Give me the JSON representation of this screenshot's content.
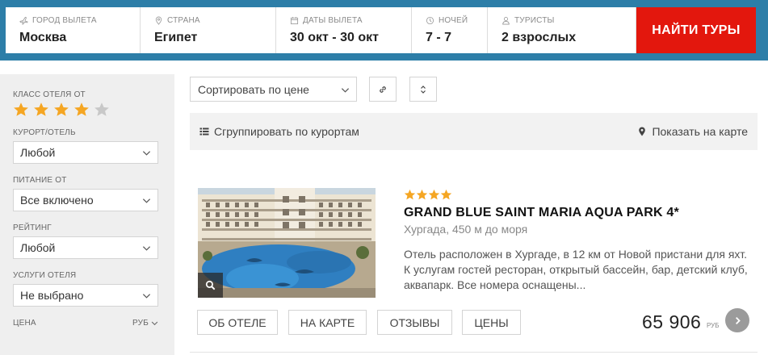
{
  "search": {
    "fields": [
      {
        "label": "Город вылета",
        "value": "Москва",
        "icon": "plane-icon"
      },
      {
        "label": "Страна",
        "value": "Египет",
        "icon": "location-pin-icon"
      },
      {
        "label": "Даты вылета",
        "value": "30 окт - 30 окт",
        "icon": "calendar-icon"
      },
      {
        "label": "Ночей",
        "value": "7 - 7",
        "icon": "moon-icon"
      },
      {
        "label": "Туристы",
        "value": "2 взрослых",
        "icon": "person-icon"
      }
    ],
    "button_label": "Найти туры"
  },
  "filters": {
    "stars_label": "Класс отеля от",
    "stars_value": 4,
    "stars_max": 5,
    "resort": {
      "label": "Курорт/отель",
      "value": "Любой"
    },
    "meal": {
      "label": "Питание от",
      "value": "Все включено"
    },
    "rating": {
      "label": "Рейтинг",
      "value": "Любой"
    },
    "services": {
      "label": "Услуги отеля",
      "value": "Не выбрано"
    },
    "price": {
      "label": "Цена",
      "currency": "руб"
    }
  },
  "toolbar": {
    "sort_value": "Сортировать по цене",
    "group_label": "Сгруппировать по курортам",
    "map_label": "Показать на карте"
  },
  "hotel": {
    "stars": 4,
    "name": "GRAND BLUE SAINT MARIA AQUA PARK 4*",
    "location": "Хургада, 450 м до моря",
    "description": "Отель расположен в Хургаде, в 12 км от Новой пристани для яхт. К услугам гостей ресторан, открытый бассейн, бар, детский клуб, аквапарк. Все номера оснащены...",
    "tabs": [
      "Об отеле",
      "На карте",
      "Отзывы",
      "Цены"
    ],
    "price": "65 906",
    "currency": "руб"
  },
  "colors": {
    "topbar": "#2d7ea8",
    "button": "#e3170d",
    "star": "#f5a623",
    "star_empty": "#c8c8c8"
  }
}
